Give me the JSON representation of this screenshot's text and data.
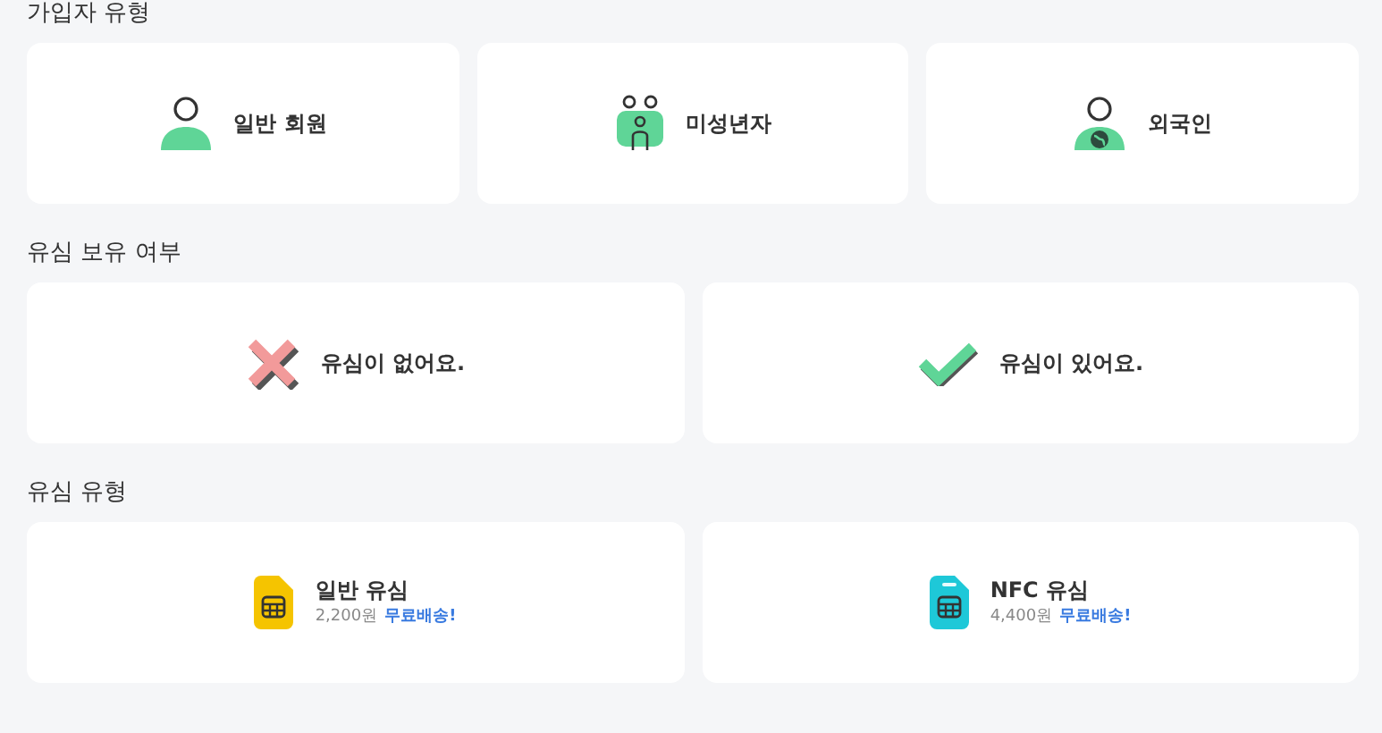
{
  "sections": [
    {
      "title": "가입자 유형",
      "options": [
        {
          "kind": "person",
          "label": "일반 회원"
        },
        {
          "kind": "family",
          "label": "미성년자"
        },
        {
          "kind": "foreigner",
          "label": "외국인"
        }
      ]
    },
    {
      "title": "유심 보유 여부",
      "options": [
        {
          "kind": "cross",
          "label": "유심이 없어요."
        },
        {
          "kind": "check",
          "label": "유심이 있어요."
        }
      ]
    },
    {
      "title": "유심 유형",
      "options": [
        {
          "kind": "sim",
          "label": "일반 유심",
          "price": "2,200원",
          "note": "무료배송!"
        },
        {
          "kind": "esim",
          "label": "NFC 유심",
          "price": "4,400원",
          "note": "무료배송!"
        }
      ]
    }
  ]
}
